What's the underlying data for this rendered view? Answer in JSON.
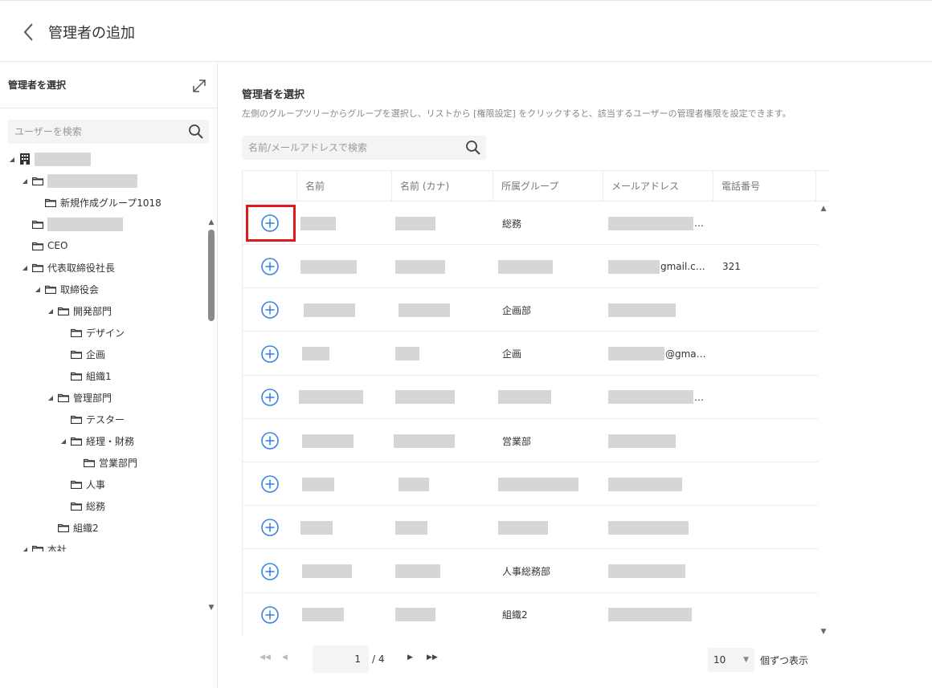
{
  "header": {
    "title": "管理者の追加"
  },
  "sidebar": {
    "title": "管理者を選択",
    "search_placeholder": "ユーザーを検索",
    "tree": [
      {
        "label": "",
        "masked": true,
        "mask_w": 70
      },
      {
        "label": "",
        "masked": true,
        "mask_w": 112
      },
      {
        "label": "新規作成グループ1018"
      },
      {
        "label": "",
        "masked": true,
        "mask_w": 94
      },
      {
        "label": "CEO"
      },
      {
        "label": "代表取締役社長"
      },
      {
        "label": "取締役会"
      },
      {
        "label": "開発部門"
      },
      {
        "label": "デザイン"
      },
      {
        "label": "企画"
      },
      {
        "label": "組織1"
      },
      {
        "label": "管理部門"
      },
      {
        "label": "テスター"
      },
      {
        "label": "経理・財務"
      },
      {
        "label": "営業部門"
      },
      {
        "label": "人事"
      },
      {
        "label": "総務"
      },
      {
        "label": "組織2"
      },
      {
        "label": "本社"
      }
    ]
  },
  "main": {
    "title": "管理者を選択",
    "description": "左側のグループツリーからグループを選択し、リストから [権限設定] をクリックすると、該当するユーザーの管理者権限を設定できます。",
    "search_placeholder": "名前/メールアドレスで検索",
    "columns": [
      "名前",
      "名前 (カナ)",
      "所属グループ",
      "メールアドレス",
      "電話番号"
    ],
    "rows": [
      {
        "name_w": 44,
        "kana_w": 50,
        "group": "総務",
        "group_w": 0,
        "email_prefix_w": 106,
        "email": "…",
        "phone": ""
      },
      {
        "name_w": 70,
        "kana_w": 62,
        "group": "",
        "group_w": 68,
        "email_prefix_w": 64,
        "email": "gmail.c…",
        "phone": "321"
      },
      {
        "name_w": 64,
        "kana_w": 64,
        "group": "企画部",
        "group_w": 0,
        "email_prefix_w": 84,
        "email": "",
        "phone": ""
      },
      {
        "name_w": 34,
        "kana_w": 30,
        "group": "企画",
        "group_w": 0,
        "email_prefix_w": 70,
        "email": "@gma…",
        "phone": ""
      },
      {
        "name_w": 80,
        "kana_w": 74,
        "group": "",
        "group_w": 66,
        "email_prefix_w": 106,
        "email": "…",
        "phone": ""
      },
      {
        "name_w": 64,
        "kana_w": 76,
        "group": "営業部",
        "group_w": 0,
        "email_prefix_w": 84,
        "email": "",
        "phone": ""
      },
      {
        "name_w": 40,
        "kana_w": 38,
        "group": "",
        "group_w": 100,
        "email_prefix_w": 92,
        "email": "",
        "phone": ""
      },
      {
        "name_w": 40,
        "kana_w": 40,
        "group": "",
        "group_w": 62,
        "email_prefix_w": 100,
        "email": "",
        "phone": ""
      },
      {
        "name_w": 62,
        "kana_w": 56,
        "group": "人事総務部",
        "group_w": 0,
        "email_prefix_w": 96,
        "email": "",
        "phone": ""
      },
      {
        "name_w": 52,
        "kana_w": 50,
        "group": "組織2",
        "group_w": 0,
        "email_prefix_w": 104,
        "email": "",
        "phone": ""
      }
    ]
  },
  "pager": {
    "current": "1",
    "total": "/ 4",
    "page_size": "10",
    "page_size_label": "個ずつ表示"
  },
  "colors": {
    "accent": "#3b82e6",
    "highlight": "#e0171c",
    "mask": "#d6d6d6"
  }
}
